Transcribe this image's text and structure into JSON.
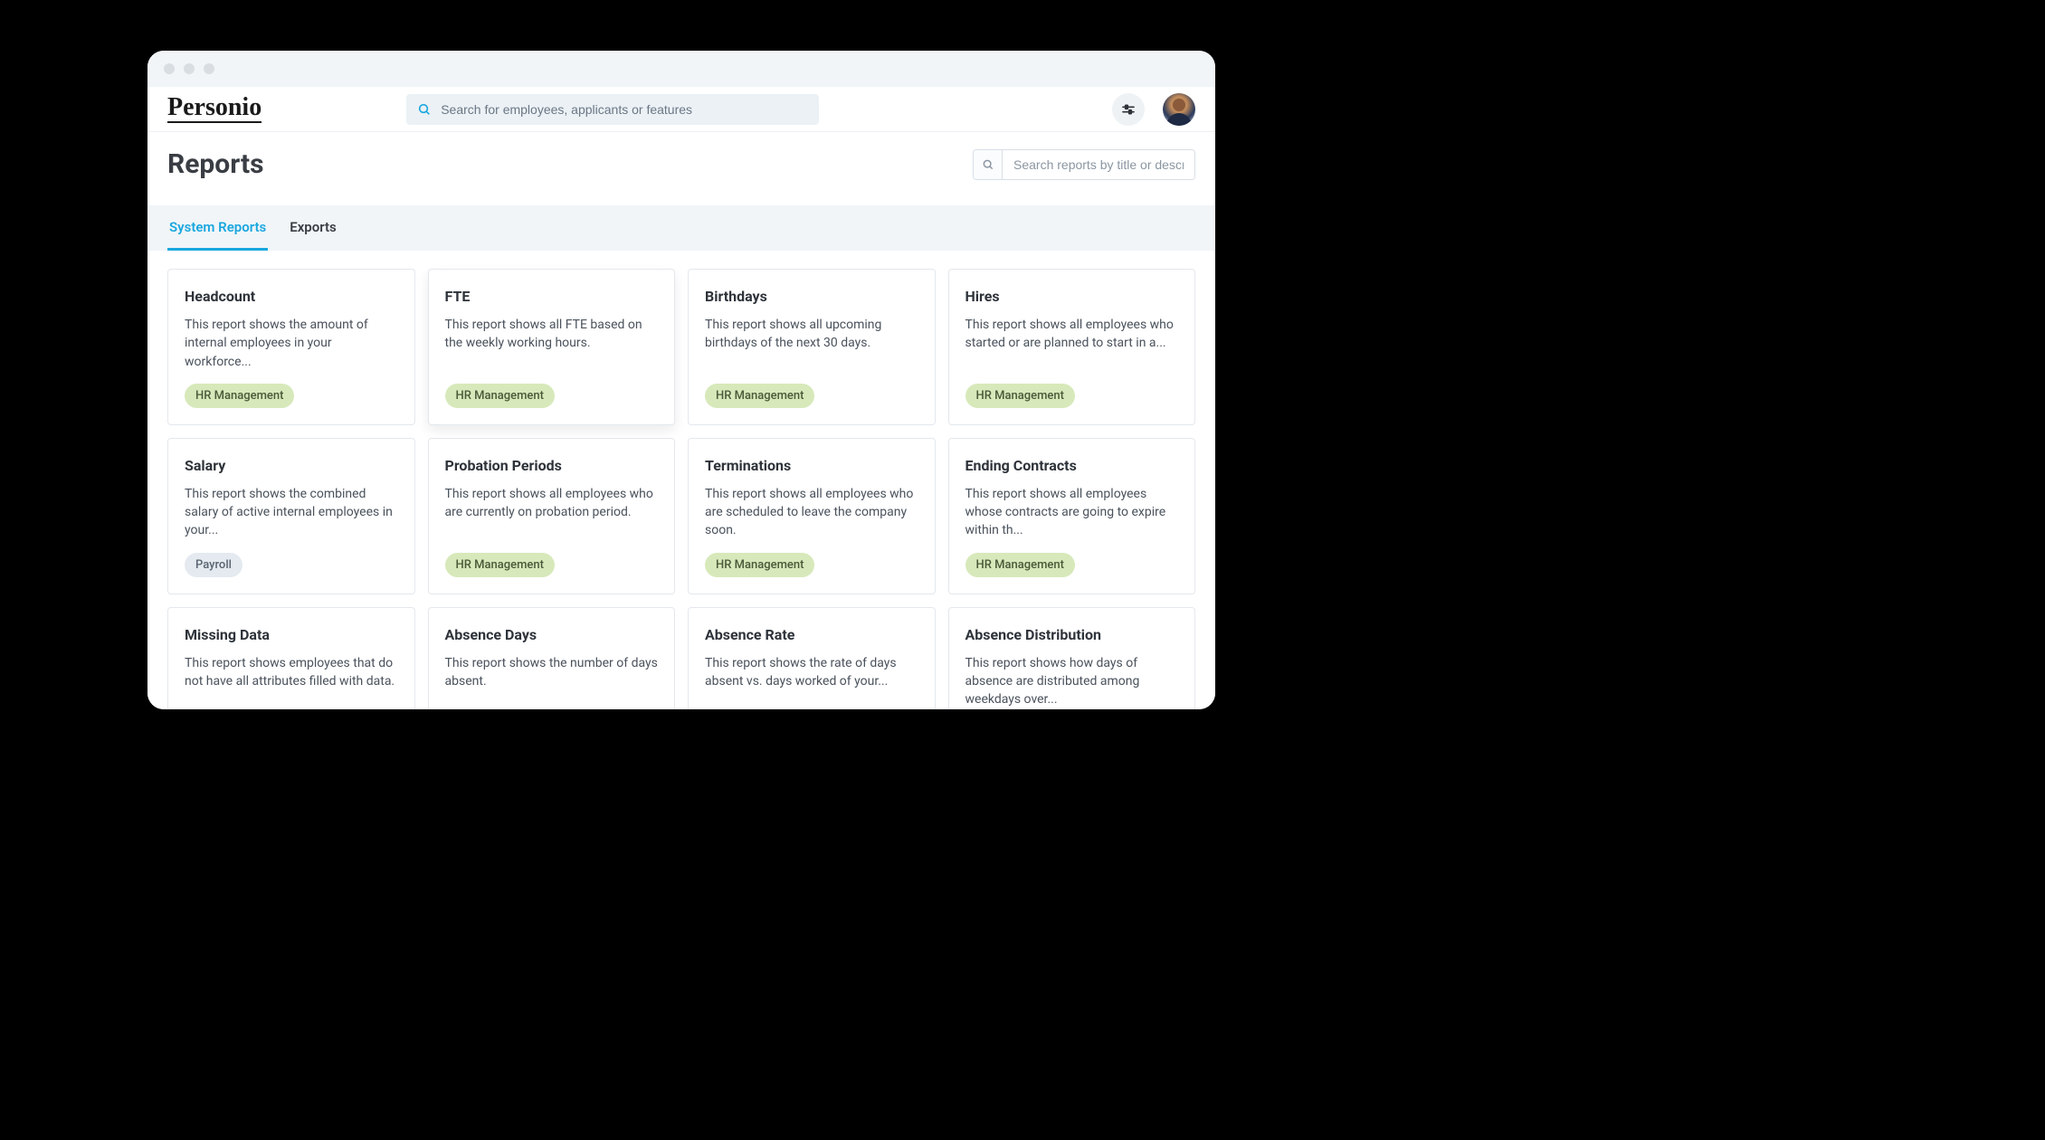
{
  "logo": "Personio",
  "global_search_placeholder": "Search for employees, applicants or features",
  "page_title": "Reports",
  "report_search_placeholder": "Search reports by title or description",
  "tabs": [
    {
      "label": "System Reports",
      "active": true
    },
    {
      "label": "Exports",
      "active": false
    }
  ],
  "tag_labels": {
    "hr": "HR Management",
    "payroll": "Payroll"
  },
  "reports": [
    {
      "title": "Headcount",
      "description": "This report shows the amount of internal employees in your workforce...",
      "tag": "hr"
    },
    {
      "title": "FTE",
      "description": "This report shows all FTE based on the weekly working hours.",
      "tag": "hr",
      "elevated": true
    },
    {
      "title": "Birthdays",
      "description": "This report shows all upcoming birthdays of the next 30 days.",
      "tag": "hr"
    },
    {
      "title": "Hires",
      "description": "This report shows all employees who started or are planned to start in a...",
      "tag": "hr"
    },
    {
      "title": "Salary",
      "description": "This report shows the combined salary of active internal employees in your...",
      "tag": "payroll"
    },
    {
      "title": "Probation Periods",
      "description": "This report shows all employees who are currently on probation period.",
      "tag": "hr"
    },
    {
      "title": "Terminations",
      "description": "This report shows all employees who are scheduled to leave the company soon.",
      "tag": "hr"
    },
    {
      "title": "Ending Contracts",
      "description": "This report shows all employees whose contracts are going to expire within th...",
      "tag": "hr"
    },
    {
      "title": "Missing Data",
      "description": "This report shows employees that do not have all attributes filled with data.",
      "tag": null
    },
    {
      "title": "Absence Days",
      "description": "This report shows the number of days absent.",
      "tag": null
    },
    {
      "title": "Absence Rate",
      "description": "This report shows the rate of days absent vs. days worked of your...",
      "tag": null
    },
    {
      "title": "Absence Distribution",
      "description": "This report shows how days of absence are distributed among weekdays over...",
      "tag": null
    }
  ]
}
